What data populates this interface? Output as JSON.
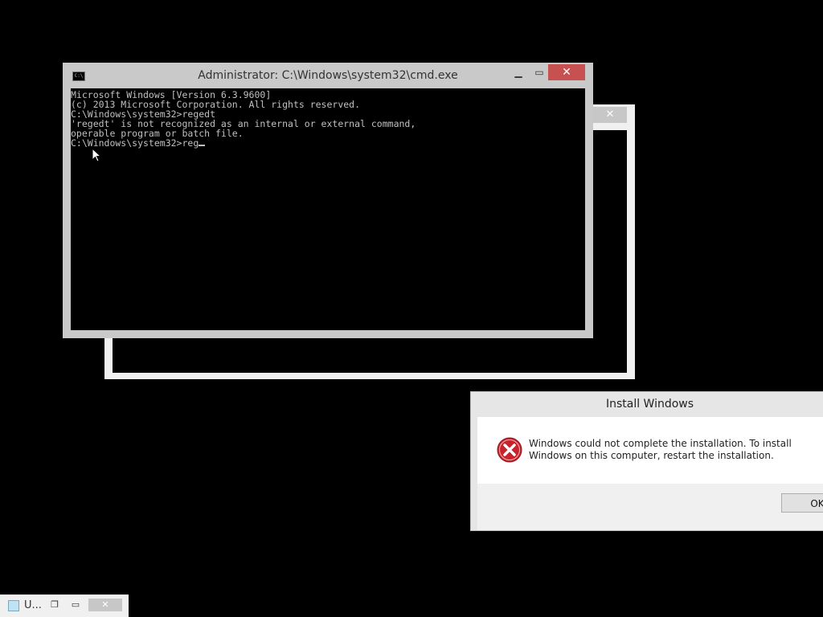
{
  "background_window": {
    "close_glyph": "✕"
  },
  "cmd_window": {
    "title": "Administrator: C:\\Windows\\system32\\cmd.exe",
    "icon_label": "C:\\",
    "min_glyph": "▁",
    "max_glyph": "▭",
    "close_glyph": "✕",
    "lines": [
      "Microsoft Windows [Version 6.3.9600]",
      "(c) 2013 Microsoft Corporation. All rights reserved.",
      "",
      "C:\\Windows\\system32>regedt",
      "'regedt' is not recognized as an internal or external command,",
      "operable program or batch file.",
      ""
    ],
    "prompt": "C:\\Windows\\system32>reg"
  },
  "dialog": {
    "title": "Install Windows",
    "message": "Windows could not complete the installation. To install Windows on this computer, restart the installation.",
    "ok_label": "OK",
    "icon": "error-icon"
  },
  "minimized_window": {
    "label": "U...",
    "restore_glyph": "❐",
    "max_glyph": "▭",
    "close_glyph": "✕"
  },
  "colors": {
    "desktop": "#000000",
    "close_active": "#c75050",
    "console_text": "#c0c0c0"
  }
}
